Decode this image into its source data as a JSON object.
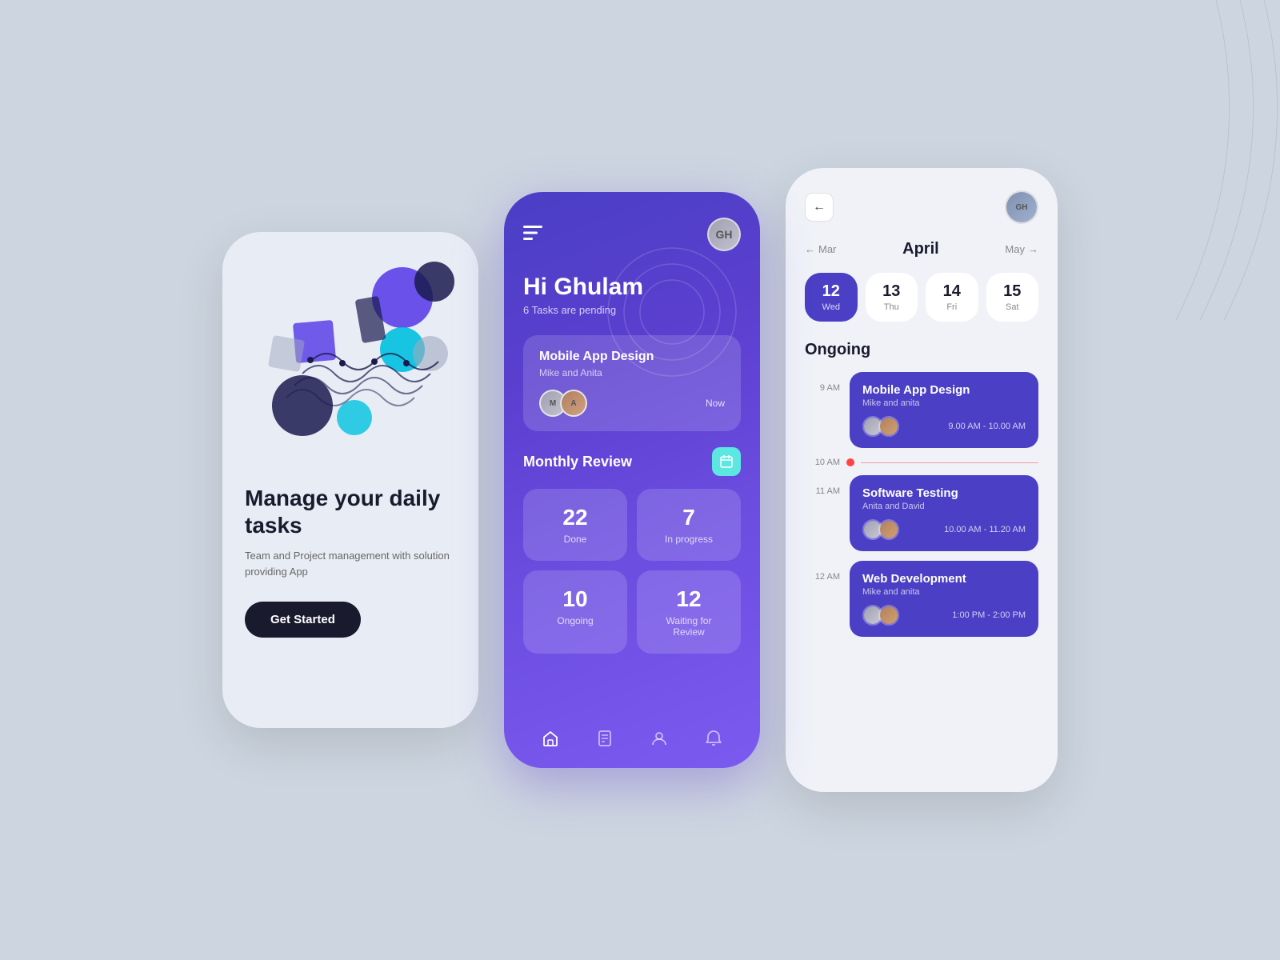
{
  "phone1": {
    "title": "Manage your daily tasks",
    "subtitle": "Team and Project management with solution providing App",
    "cta": "Get Started"
  },
  "phone2": {
    "bars_icon": "|||",
    "greeting": "Hi Ghulam",
    "tasks_pending": "6 Tasks are pending",
    "task_card": {
      "title": "Mobile App Design",
      "subtitle": "Mike and Anita",
      "time": "Now"
    },
    "monthly_review": {
      "title": "Monthly Review",
      "stats": [
        {
          "number": "22",
          "label": "Done"
        },
        {
          "number": "7",
          "label": "In progress"
        },
        {
          "number": "10",
          "label": "Ongoing"
        },
        {
          "number": "12",
          "label": "Waiting for Review"
        }
      ]
    },
    "nav": [
      "🏠",
      "📄",
      "👤",
      "🔔"
    ]
  },
  "phone3": {
    "month": "April",
    "prev_month": "Mar",
    "next_month": "May",
    "dates": [
      {
        "num": "12",
        "day": "Wed",
        "active": true
      },
      {
        "num": "13",
        "day": "Thu",
        "active": false
      },
      {
        "num": "14",
        "day": "Fri",
        "active": false
      },
      {
        "num": "15",
        "day": "Sat",
        "active": false
      }
    ],
    "section_title": "Ongoing",
    "events": [
      {
        "time_start": "9 AM",
        "title": "Mobile App Design",
        "subtitle": "Mike and anita",
        "time_range": "9.00 AM - 10.00 AM",
        "avatars": [
          "av1",
          "av2"
        ]
      },
      {
        "time_start": "11 AM",
        "title": "Software Testing",
        "subtitle": "Anita and David",
        "time_range": "10.00 AM - 11.20 AM",
        "avatars": [
          "av1",
          "av2"
        ]
      },
      {
        "time_start": "12 AM",
        "title": "Web Development",
        "subtitle": "Mike and anita",
        "time_range": "1:00 PM - 2:00 PM",
        "avatars": [
          "av1",
          "av2"
        ]
      }
    ],
    "current_time": "10 AM"
  }
}
